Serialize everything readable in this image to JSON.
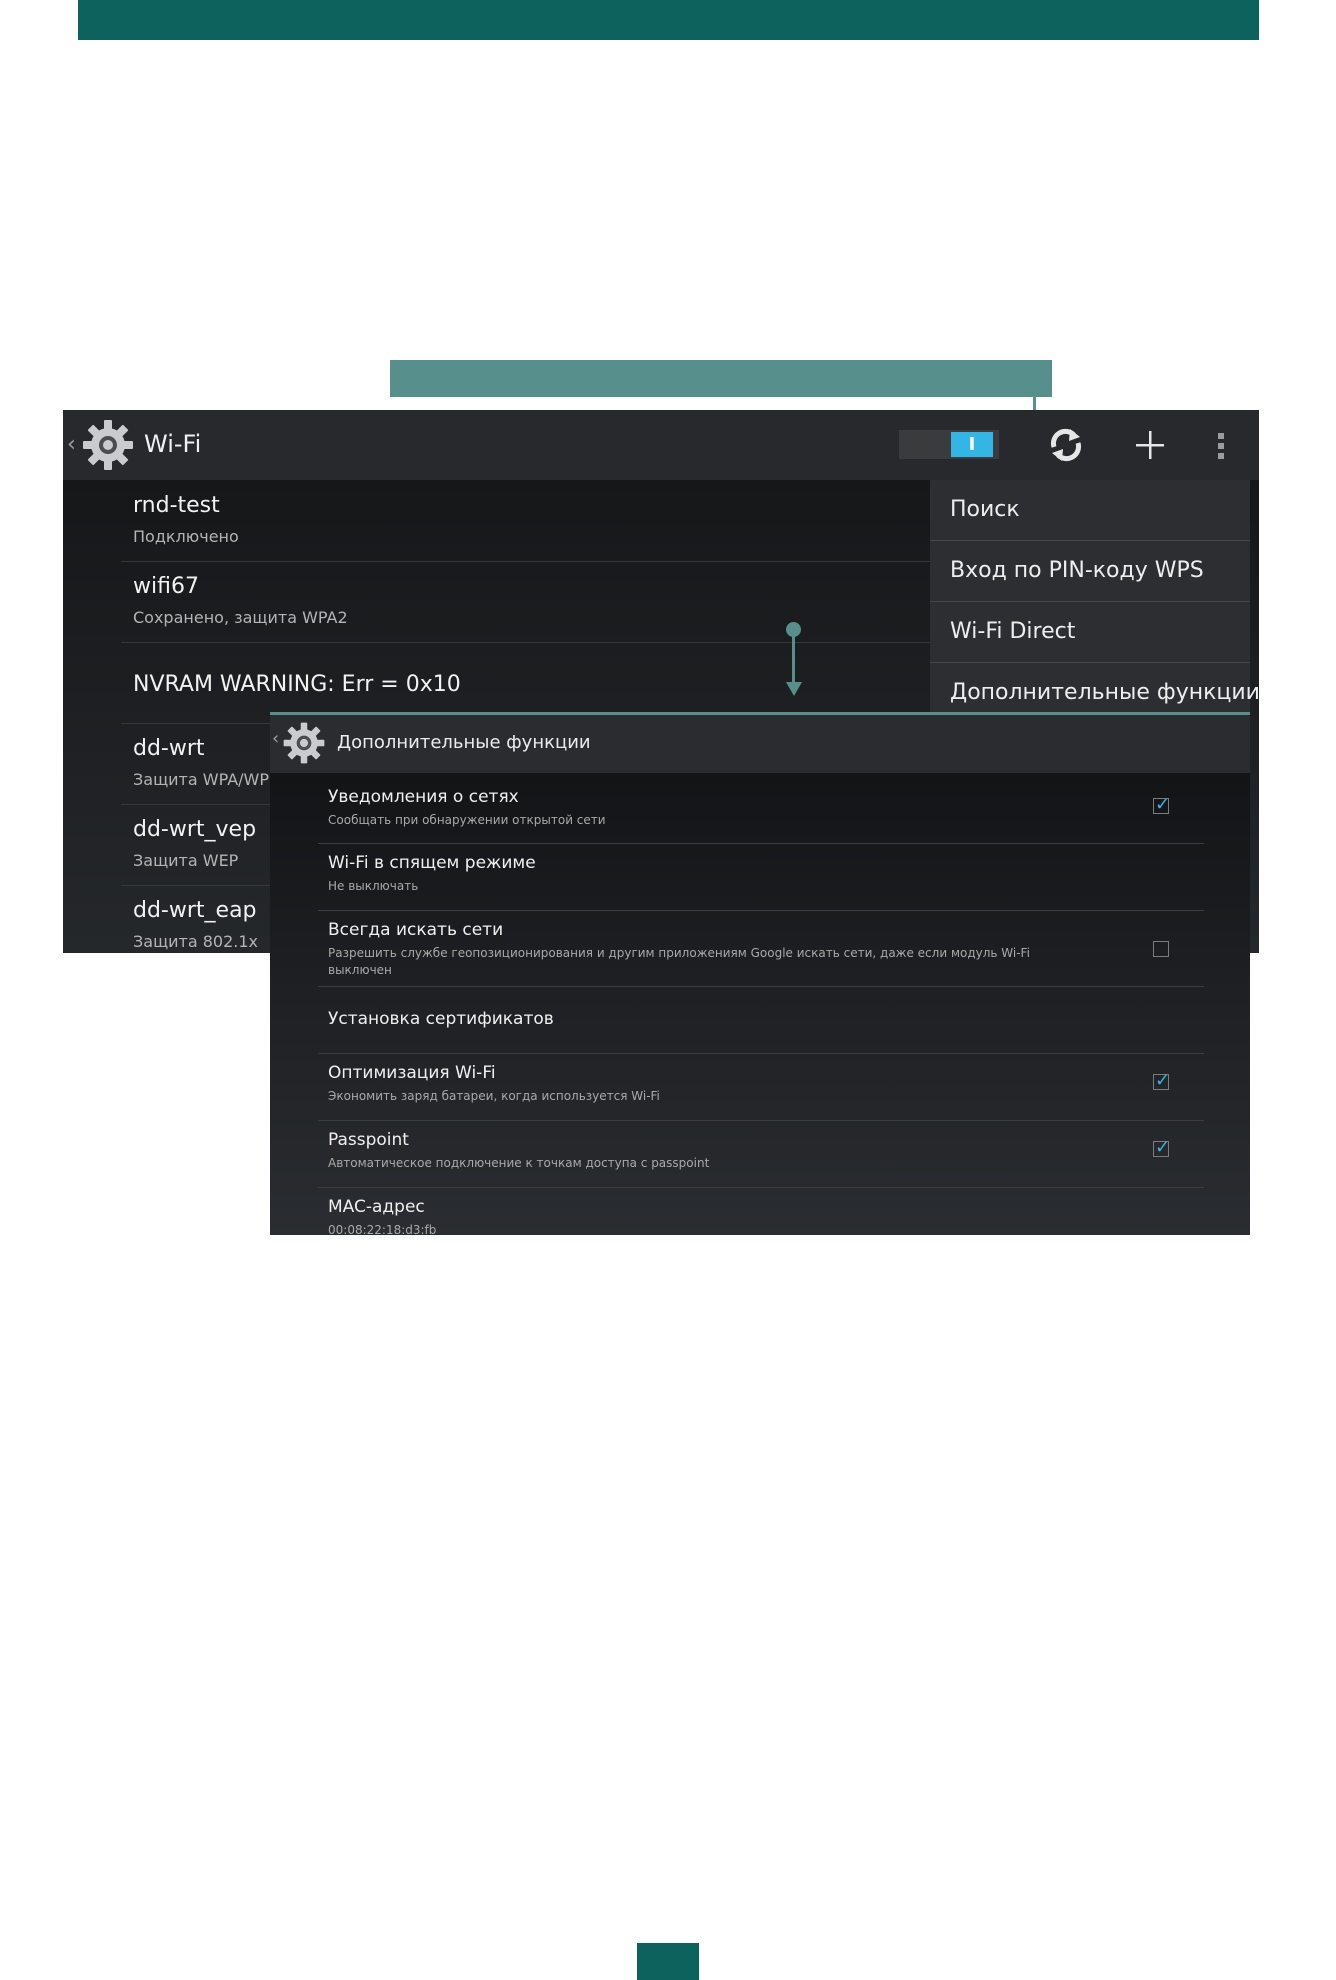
{
  "wifi_screen": {
    "back_icon": "chevron-left-icon",
    "settings_icon": "gear-icon",
    "title": "Wi-Fi",
    "switch_label": "I",
    "toolbar_icons": [
      "refresh-icon",
      "add-icon",
      "overflow-menu-icon"
    ],
    "networks": [
      {
        "name": "rnd-test",
        "status": "Подключено"
      },
      {
        "name": "wifi67",
        "status": "Сохранено, защита WPA2"
      },
      {
        "name": "NVRAM WARNING: Err = 0x10",
        "status": ""
      },
      {
        "name": "dd-wrt",
        "status": "Защита WPA/WP"
      },
      {
        "name": "dd-wrt_vep",
        "status": "Защита WEP"
      },
      {
        "name": "dd-wrt_eap",
        "status": "Защита 802.1x"
      }
    ],
    "menu": {
      "items": [
        "Поиск",
        "Вход по PIN-коду WPS",
        "Wi-Fi Direct",
        "Дополнительные функции"
      ]
    }
  },
  "advanced_screen": {
    "back_icon": "chevron-left-icon",
    "settings_icon": "gear-icon",
    "title": "Дополнительные функции",
    "prefs": [
      {
        "title": "Уведомления о сетях",
        "summary": "Сообщать при обнаружении открытой сети",
        "checkbox": true,
        "checked": true
      },
      {
        "title": "Wi-Fi в спящем режиме",
        "summary": "Не выключать",
        "checkbox": false
      },
      {
        "title": "Всегда искать сети",
        "summary": "Разрешить службе геопозиционирования и другим приложениям Google искать сети, даже если модуль Wi-Fi",
        "summary2": "выключен",
        "checkbox": true,
        "checked": false
      },
      {
        "title": "Установка сертификатов",
        "summary": "",
        "checkbox": false
      },
      {
        "title": "Оптимизация Wi-Fi",
        "summary": "Экономить заряд батареи, когда используется Wi-Fi",
        "checkbox": true,
        "checked": true
      },
      {
        "title": "Passpoint",
        "summary": "Автоматическое подключение к точкам доступа с passpoint",
        "checkbox": true,
        "checked": true
      },
      {
        "title": "MAC-адрес",
        "summary": "00:08:22:18:d3:fb",
        "checkbox": false
      }
    ]
  },
  "colors": {
    "brand_teal": "#0d625d",
    "callout_teal": "#568f8c",
    "holo_blue": "#33b5e5"
  }
}
